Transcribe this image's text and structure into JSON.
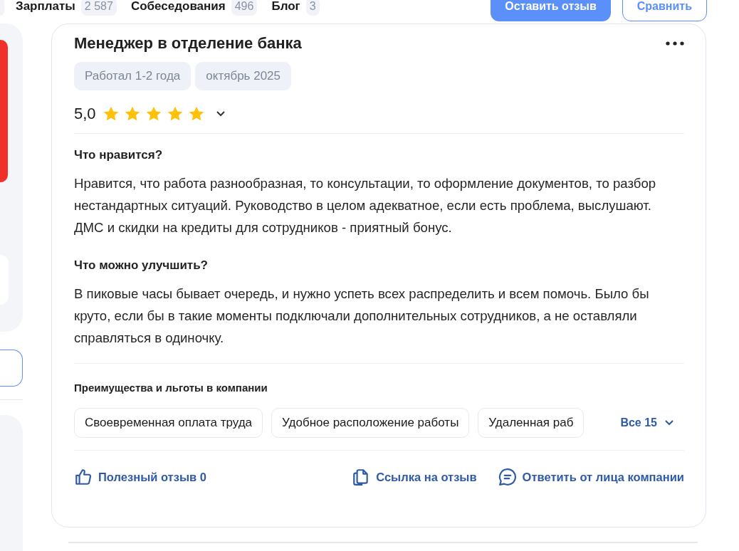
{
  "nav": {
    "items": [
      {
        "label": "Зарплаты",
        "count": "2 587"
      },
      {
        "label": "Собеседования",
        "count": "496"
      },
      {
        "label": "Блог",
        "count": "3"
      }
    ],
    "buttons": [
      {
        "label": "Оставить отзыв",
        "kind": "primary"
      },
      {
        "label": "Сравнить",
        "kind": "outline"
      }
    ]
  },
  "review": {
    "title": "Менеджер в отделение банка",
    "tags": [
      "Работал 1-2 года",
      "октябрь 2025"
    ],
    "rating": "5,0",
    "stars": 5,
    "sections": [
      {
        "heading": "Что нравится?",
        "text": "Нравится, что работа разнообразная, то консультации, то оформление документов, то разбор нестандартных ситуаций. Руководство в целом адекватное, если есть проблема, выслушают. ДМС и скидки на кредиты для сотрудников - приятный бонус."
      },
      {
        "heading": "Что можно улучшить?",
        "text": "В пиковые часы бывает очередь, и нужно успеть всех распределить и всем помочь. Было бы круто, если бы в такие моменты подключали дополнительных сотрудников, а не оставляли справляться в одиночку."
      }
    ],
    "benefits": {
      "heading": "Преимущества и льготы в компании",
      "items": [
        "Своевременная оплата труда",
        "Удобное расположение работы",
        "Удаленная раб"
      ],
      "more": "Все 15"
    },
    "actions": [
      {
        "kind": "like",
        "label": "Полезный отзыв 0"
      },
      {
        "kind": "link",
        "label": "Ссылка на отзыв"
      },
      {
        "kind": "reply",
        "label": "Ответить от лица компании"
      }
    ]
  }
}
